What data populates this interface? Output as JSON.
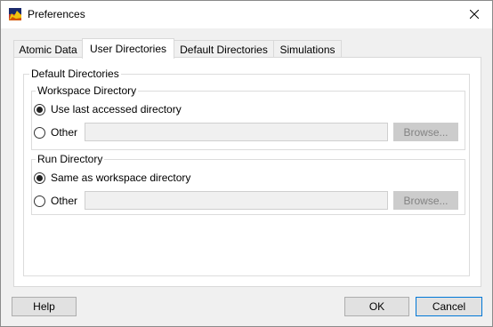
{
  "window": {
    "title": "Preferences",
    "app_icon": "app-logo-icon",
    "close_icon": "close-icon"
  },
  "tabs": [
    {
      "label": "Atomic Data",
      "active": false
    },
    {
      "label": "User Directories",
      "active": true
    },
    {
      "label": "Default Directories",
      "active": false
    },
    {
      "label": "Simulations",
      "active": false
    }
  ],
  "panel": {
    "section_label": "Default Directories",
    "workspace": {
      "label": "Workspace Directory",
      "option_last": "Use last accessed directory",
      "option_other": "Other",
      "selected": "last",
      "other_value": "",
      "browse_label": "Browse..."
    },
    "run": {
      "label": "Run Directory",
      "option_same": "Same as workspace directory",
      "option_other": "Other",
      "selected": "same",
      "other_value": "",
      "browse_label": "Browse..."
    }
  },
  "footer": {
    "help_label": "Help",
    "ok_label": "OK",
    "cancel_label": "Cancel"
  },
  "colors": {
    "accent": "#0078d7",
    "window_bg": "#f0f0f0",
    "panel_bg": "#ffffff"
  }
}
